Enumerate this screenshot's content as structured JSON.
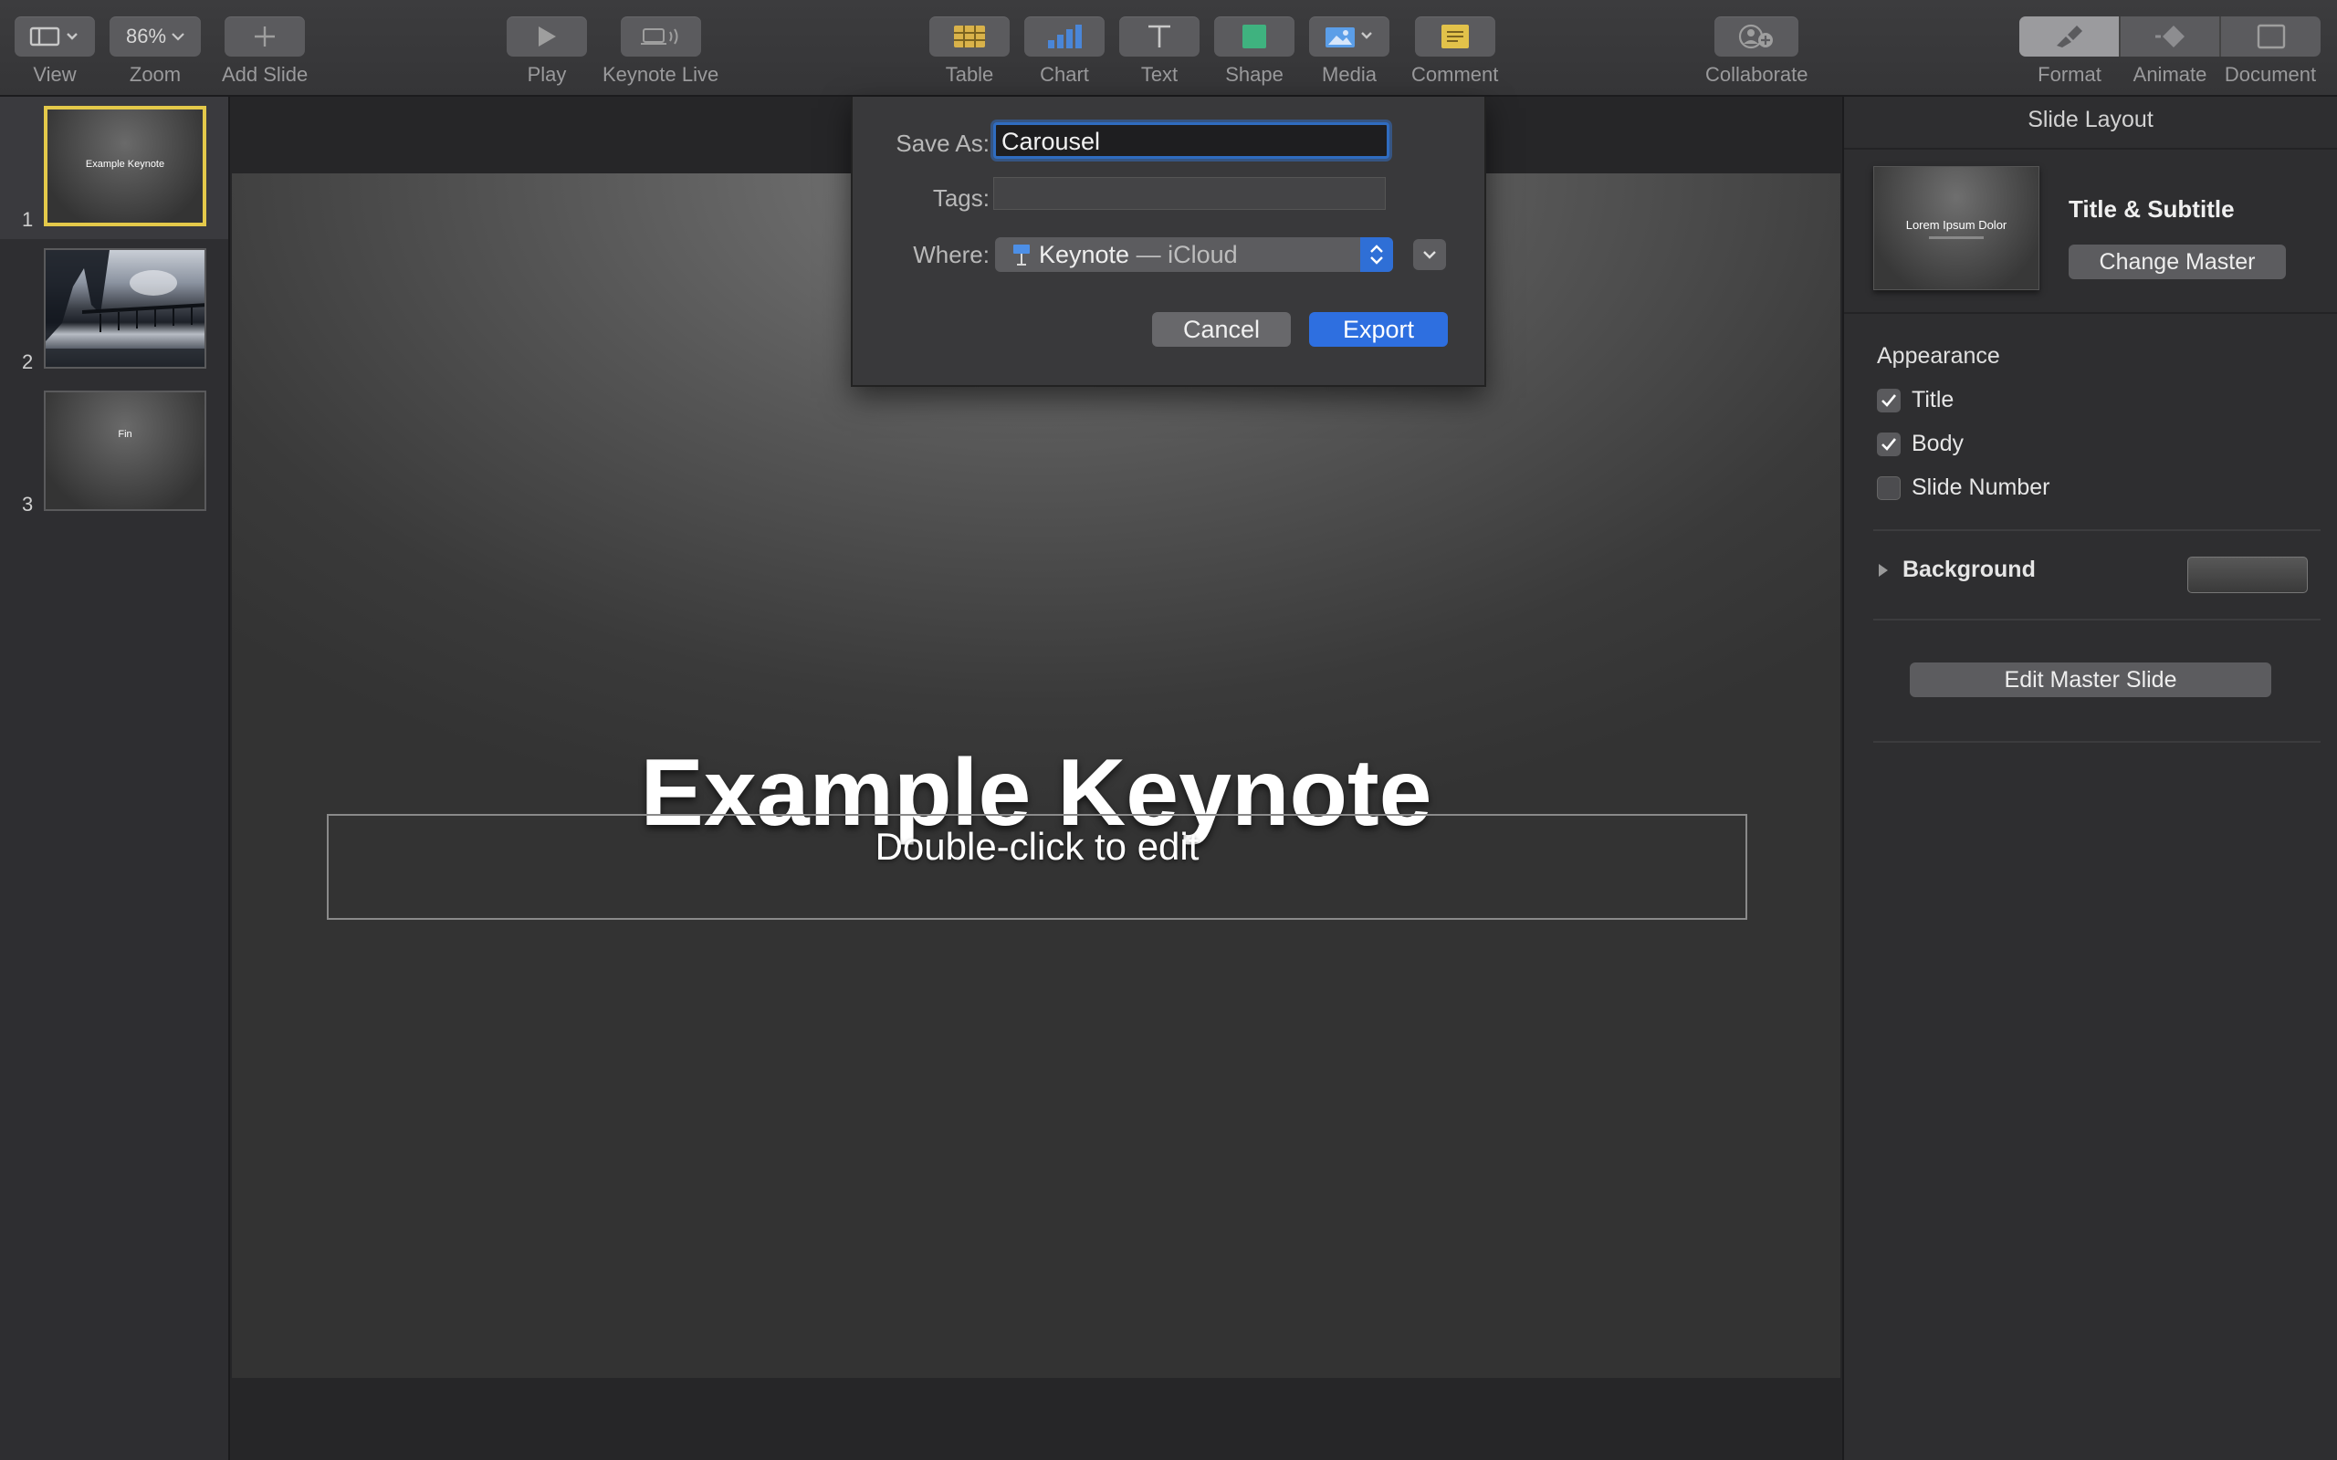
{
  "toolbar": {
    "view_label": "View",
    "zoom_value": "86%",
    "zoom_label": "Zoom",
    "add_slide_label": "Add Slide",
    "play_label": "Play",
    "keynote_live_label": "Keynote Live",
    "table_label": "Table",
    "chart_label": "Chart",
    "text_label": "Text",
    "shape_label": "Shape",
    "media_label": "Media",
    "comment_label": "Comment",
    "collaborate_label": "Collaborate",
    "format_label": "Format",
    "animate_label": "Animate",
    "document_label": "Document",
    "colors": {
      "table": "#d9b24a",
      "chart": "#4a86d8",
      "shape": "#3fb27f",
      "media": "#5b9ee8",
      "comment": "#e2c24a"
    }
  },
  "navigator": {
    "slides": [
      {
        "number": "1",
        "thumb_text": "Example Keynote",
        "selected": true
      },
      {
        "number": "2",
        "thumb_text": "",
        "selected": false
      },
      {
        "number": "3",
        "thumb_text": "Fin",
        "selected": false
      }
    ],
    "selection_color": "#e4c94a"
  },
  "slide": {
    "title": "Example Keynote",
    "subtitle_placeholder": "Double-click to edit"
  },
  "export_dialog": {
    "save_as_label": "Save As:",
    "save_as_value": "Carousel",
    "tags_label": "Tags:",
    "where_label": "Where:",
    "where_app": "Keynote",
    "where_location": "— iCloud",
    "cancel_label": "Cancel",
    "export_label": "Export",
    "accent_color": "#2e6fe0"
  },
  "inspector": {
    "header": "Slide Layout",
    "layout_thumb_text": "Lorem Ipsum Dolor",
    "layout_name": "Title & Subtitle",
    "change_master_label": "Change Master",
    "appearance_label": "Appearance",
    "options": [
      {
        "label": "Title",
        "checked": true
      },
      {
        "label": "Body",
        "checked": true
      },
      {
        "label": "Slide Number",
        "checked": false
      }
    ],
    "background_label": "Background",
    "edit_master_label": "Edit Master Slide"
  }
}
